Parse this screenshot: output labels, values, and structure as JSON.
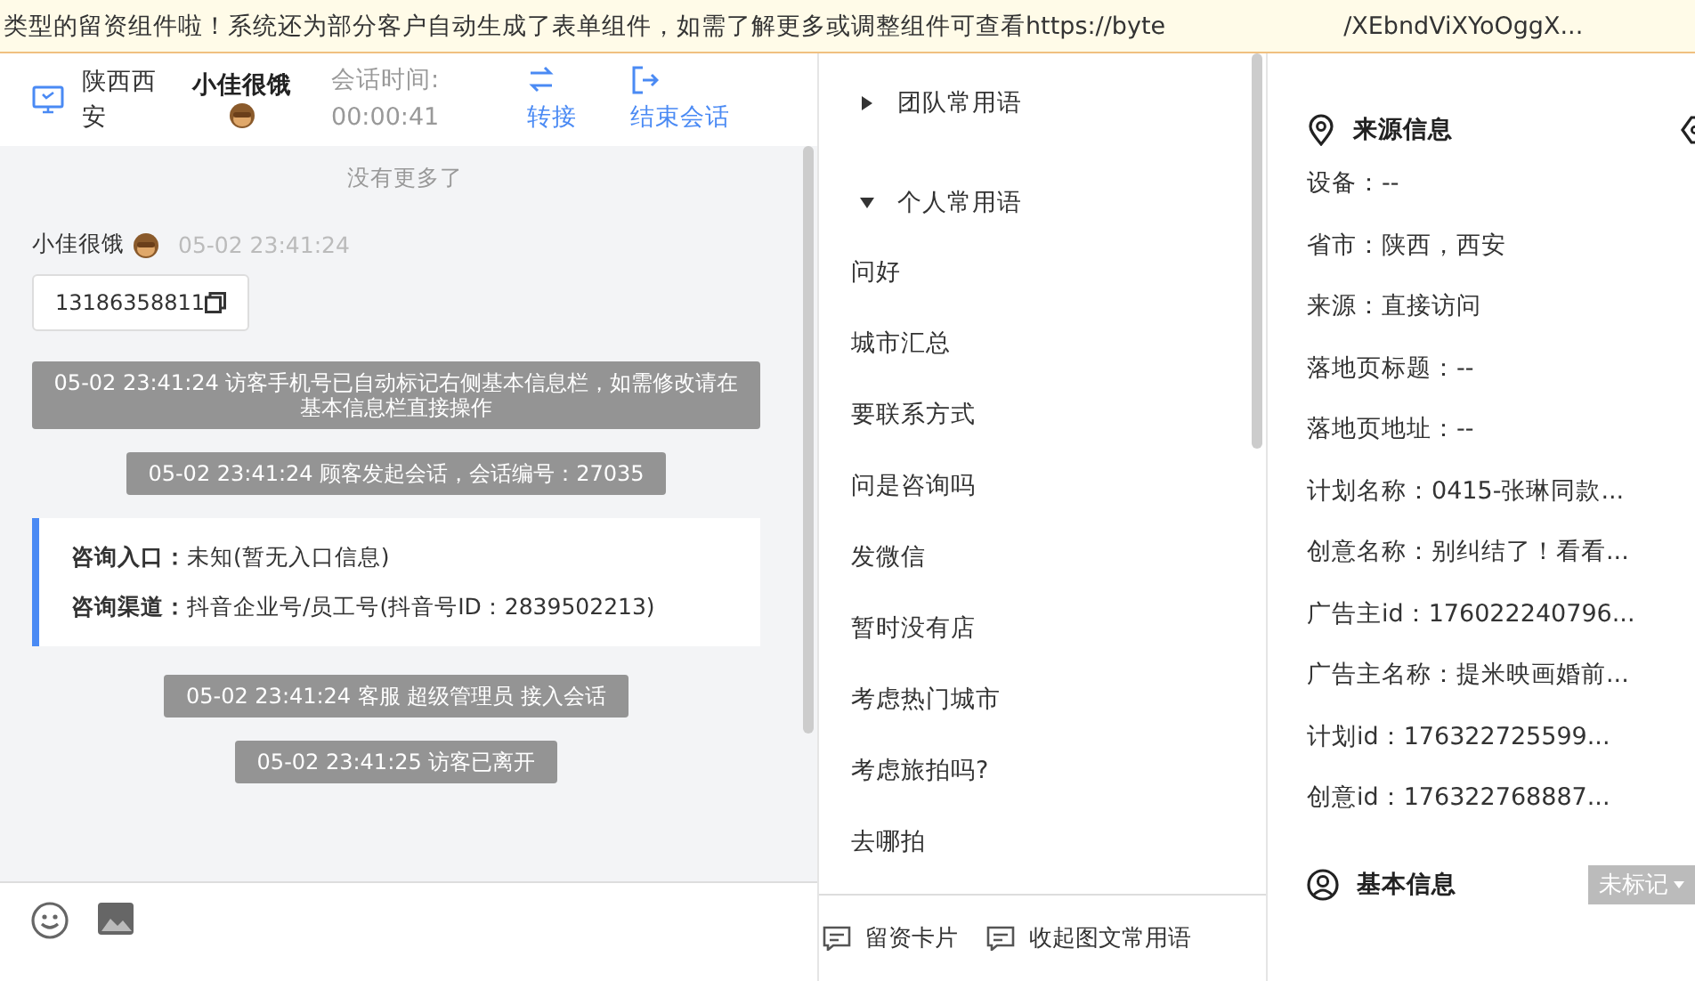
{
  "banner": {
    "text": "类型的留资组件啦！系统还为部分客户自动生成了表单组件，如需了解更多或调整组件可查看https://byte",
    "text_tail": "/XEbndViXYoOggX..."
  },
  "header": {
    "location": "陕西西安",
    "visitor": "小佳很饿",
    "timer_label": "会话时间:",
    "timer": "00:00:41",
    "actions": [
      {
        "label": "转接",
        "kind": "transfer"
      },
      {
        "label": "结束会话",
        "kind": "end"
      }
    ]
  },
  "chat": {
    "no_more": "没有更多了",
    "messages": [
      {
        "kind": "visitor",
        "sender": "小佳很饿",
        "time": "05-02 23:41:24",
        "text": "13186358811"
      },
      {
        "kind": "system",
        "text": "05-02 23:41:24 访客手机号已自动标记右侧基本信息栏，如需修改请在基本信息栏直接操作"
      },
      {
        "kind": "system",
        "text": "05-02 23:41:24 顾客发起会话，会话编号：27035"
      },
      {
        "kind": "info",
        "rows": [
          {
            "label": "咨询入口：",
            "value": "未知(暂无入口信息)"
          },
          {
            "label": "咨询渠道：",
            "value": "抖音企业号/员工号(抖音号ID：2839502213)"
          }
        ]
      },
      {
        "kind": "system",
        "text": "05-02 23:41:24 客服 超级管理员 接入会话"
      },
      {
        "kind": "system",
        "text": "05-02 23:41:25 访客已离开"
      }
    ]
  },
  "phrases": {
    "groups": [
      {
        "label": "团队常用语",
        "expanded": false
      },
      {
        "label": "个人常用语",
        "expanded": true,
        "items": [
          "问好",
          "城市汇总",
          "要联系方式",
          "问是咨询吗",
          "发微信",
          "暂时没有店",
          "考虑热门城市",
          "考虑旅拍吗?",
          "去哪拍"
        ]
      }
    ],
    "buttons": [
      {
        "label": "留资卡片"
      },
      {
        "label": "收起图文常用语"
      }
    ]
  },
  "source": {
    "title": "来源信息",
    "fields": [
      "设备：--",
      "省市：陕西，西安",
      "来源：直接访问",
      "落地页标题：--",
      "落地页地址：--",
      "计划名称：0415-张琳同款...",
      "创意名称：别纠结了！看看...",
      "广告主id：176022240796...",
      "广告主名称：提米映画婚前...",
      "计划id：176322725599...",
      "创意id：176322768887..."
    ]
  },
  "basic": {
    "title": "基本信息",
    "tag": "未标记"
  }
}
